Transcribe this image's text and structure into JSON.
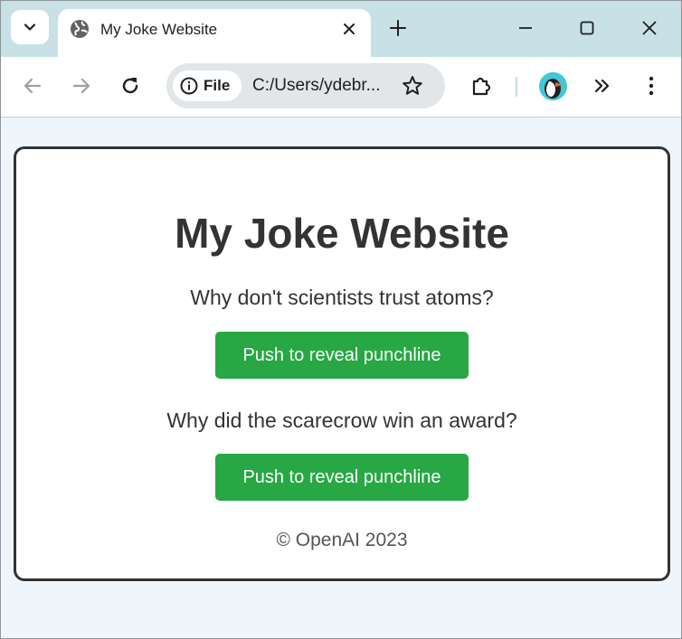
{
  "browser": {
    "tab": {
      "title": "My Joke Website"
    },
    "address_bar": {
      "site_chip_label": "File",
      "url": "C:/Users/ydebr..."
    }
  },
  "page": {
    "title": "My Joke Website",
    "jokes": [
      {
        "question": "Why don't scientists trust atoms?",
        "button_label": "Push to reveal punchline"
      },
      {
        "question": "Why did the scarecrow win an award?",
        "button_label": "Push to reveal punchline"
      }
    ],
    "footer": "© OpenAI 2023"
  },
  "colors": {
    "tabstrip": "#c8e1e6",
    "button": "#28a745",
    "page_background": "#eef6fc",
    "card_border": "#333333"
  }
}
